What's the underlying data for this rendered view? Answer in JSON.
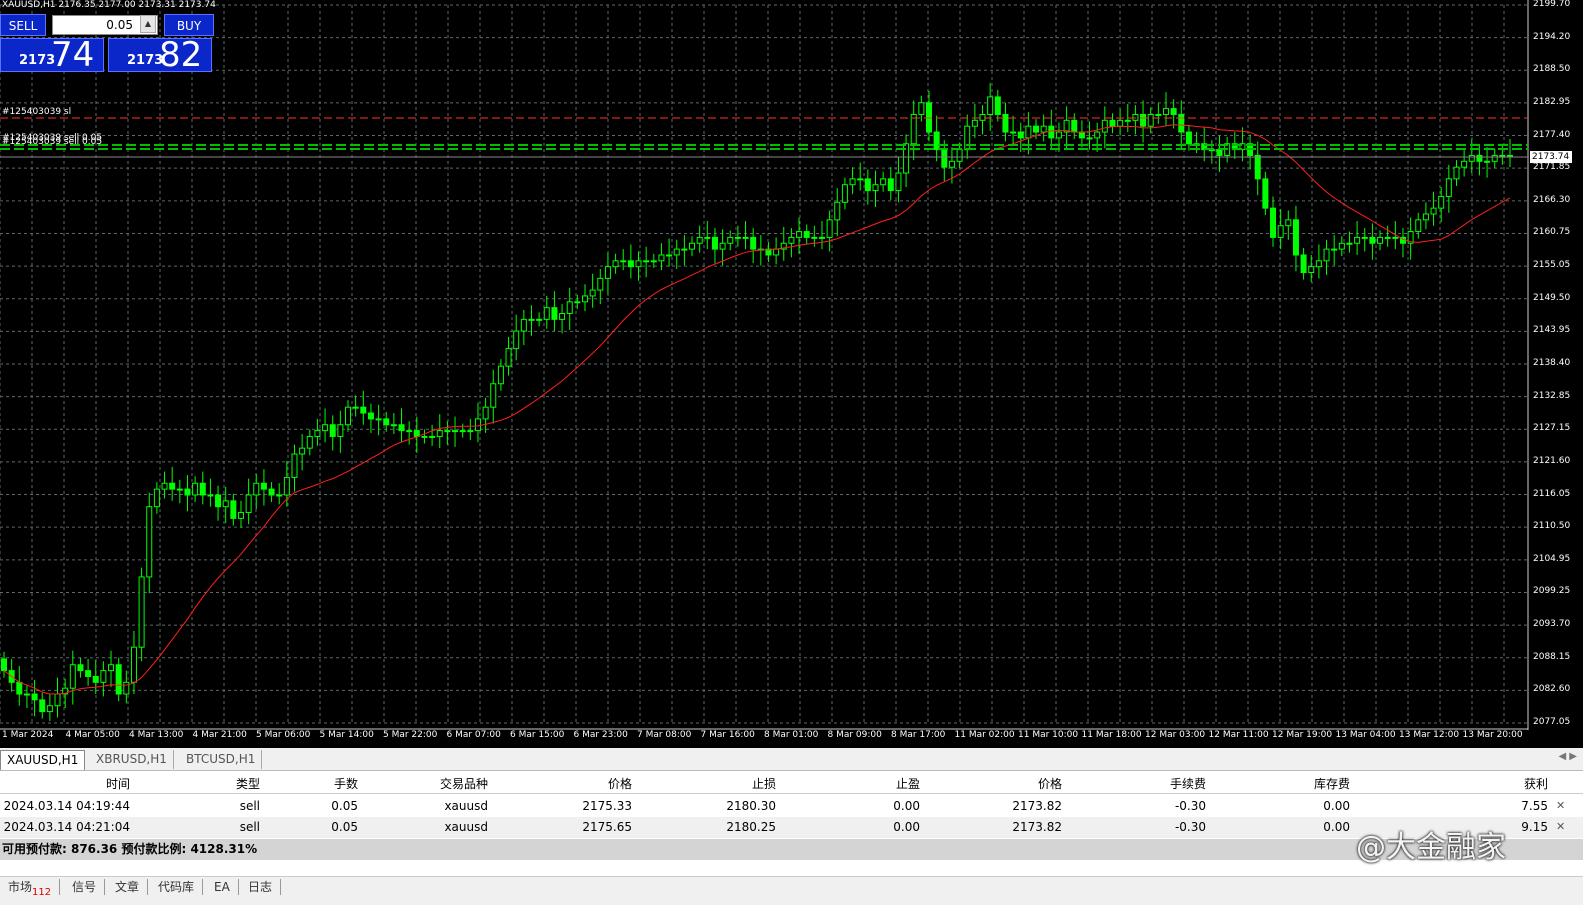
{
  "chart": {
    "info_line": "XAUUSD,H1  2176.35 2177.00 2173.31 2173.74",
    "lot_value": "0.05",
    "sell_label": "SELL",
    "buy_label": "BUY",
    "sell_price_small": "2173",
    "sell_price_big": "74",
    "buy_price_small": "2173",
    "buy_price_big": "82",
    "order_sl_label": "#125403039 sl",
    "order_sell_label": "#125403039 sell 0.05",
    "current_price": "2173.74",
    "y_labels": [
      "2199.70",
      "2194.20",
      "2188.50",
      "2182.95",
      "2177.40",
      "2171.85",
      "2166.30",
      "2160.75",
      "2155.05",
      "2149.50",
      "2143.95",
      "2138.40",
      "2132.85",
      "2127.15",
      "2121.60",
      "2116.05",
      "2110.50",
      "2104.95",
      "2099.25",
      "2093.70",
      "2088.15",
      "2082.60",
      "2077.05"
    ],
    "x_labels": [
      "1 Mar 2024",
      "4 Mar 05:00",
      "4 Mar 13:00",
      "4 Mar 21:00",
      "5 Mar 06:00",
      "5 Mar 14:00",
      "5 Mar 22:00",
      "6 Mar 07:00",
      "6 Mar 15:00",
      "6 Mar 23:00",
      "7 Mar 08:00",
      "7 Mar 16:00",
      "8 Mar 01:00",
      "8 Mar 09:00",
      "8 Mar 17:00",
      "11 Mar 02:00",
      "11 Mar 10:00",
      "11 Mar 18:00",
      "12 Mar 03:00",
      "12 Mar 11:00",
      "12 Mar 19:00",
      "13 Mar 04:00",
      "13 Mar 12:00",
      "13 Mar 20:00"
    ],
    "colors": {
      "background": "#000000",
      "candle": "#00ff00",
      "ma": "#ff2020",
      "grid": "#5a6a6a",
      "sl_line": "#ff3030",
      "order_line": "#00c000"
    }
  },
  "chart_data": {
    "type": "candlestick",
    "y_range": [
      2077.05,
      2199.7
    ],
    "close": [
      2086,
      2084,
      2082,
      2082,
      2081,
      2079,
      2080,
      2082,
      2083,
      2087,
      2086,
      2085,
      2084,
      2086,
      2087,
      2082,
      2084,
      2090,
      2102,
      2114,
      2117,
      2118,
      2117,
      2117,
      2116,
      2118,
      2116,
      2116,
      2114,
      2115,
      2112,
      2113,
      2116,
      2118,
      2117,
      2116,
      2116,
      2119,
      2123,
      2124,
      2126,
      2127,
      2128,
      2126,
      2128,
      2131,
      2131,
      2130,
      2129,
      2129,
      2128,
      2128,
      2127,
      2127,
      2126,
      2126,
      2126,
      2127,
      2127,
      2127,
      2127,
      2127,
      2129,
      2131,
      2135,
      2138,
      2141,
      2144,
      2146,
      2146,
      2146,
      2148,
      2146,
      2147,
      2149,
      2149,
      2150,
      2151,
      2153,
      2155,
      2156,
      2156,
      2155,
      2156,
      2156,
      2156,
      2157,
      2157,
      2158,
      2158,
      2159,
      2160,
      2160,
      2158,
      2159,
      2160,
      2160,
      2160,
      2158,
      2158,
      2157,
      2158,
      2159,
      2160,
      2161,
      2160,
      2160,
      2160,
      2163,
      2166,
      2169,
      2170,
      2170,
      2168,
      2169,
      2170,
      2168,
      2171,
      2176,
      2181,
      2183,
      2178,
      2175,
      2172,
      2173,
      2175,
      2179,
      2180,
      2181,
      2184,
      2181,
      2178,
      2178,
      2177,
      2179,
      2178,
      2179,
      2177,
      2178,
      2180,
      2178,
      2177,
      2177,
      2178,
      2180,
      2179,
      2180,
      2180,
      2181,
      2179,
      2181,
      2181,
      2182,
      2181,
      2178,
      2176,
      2176,
      2175,
      2175,
      2174,
      2176,
      2175,
      2176,
      2174,
      2170,
      2165,
      2160,
      2162,
      2163,
      2157,
      2154,
      2155,
      2156,
      2158,
      2158,
      2159,
      2159,
      2160,
      2160,
      2159,
      2160,
      2160,
      2160,
      2159,
      2161,
      2163,
      2164,
      2165,
      2167,
      2170,
      2172,
      2173,
      2174,
      2173,
      2173,
      2174,
      2174,
      2174
    ]
  },
  "table": {
    "headers": [
      "时间",
      "类型",
      "手数",
      "交易品种",
      "价格",
      "止损",
      "止盈",
      "价格",
      "手续费",
      "库存费",
      "获利"
    ],
    "rows": [
      [
        "2024.03.14 04:19:44",
        "sell",
        "0.05",
        "xauusd",
        "2175.33",
        "2180.30",
        "0.00",
        "2173.82",
        "-0.30",
        "0.00",
        "7.55"
      ],
      [
        "2024.03.14 04:21:04",
        "sell",
        "0.05",
        "xauusd",
        "2175.65",
        "2180.25",
        "0.00",
        "2173.82",
        "-0.30",
        "0.00",
        "9.15"
      ]
    ],
    "summary": "可用预付款: 876.36  预付款比例: 4128.31%"
  },
  "chart_tabs": [
    "XAUUSD,H1",
    "XBRUSD,H1",
    "BTCUSD,H1"
  ],
  "bottom_tabs": [
    {
      "label": "市场",
      "badge": "112"
    },
    {
      "label": "信号",
      "badge": ""
    },
    {
      "label": "文章",
      "badge": ""
    },
    {
      "label": "代码库",
      "badge": ""
    },
    {
      "label": "EA",
      "badge": ""
    },
    {
      "label": "日志",
      "badge": ""
    }
  ],
  "watermark": "@大金融家"
}
